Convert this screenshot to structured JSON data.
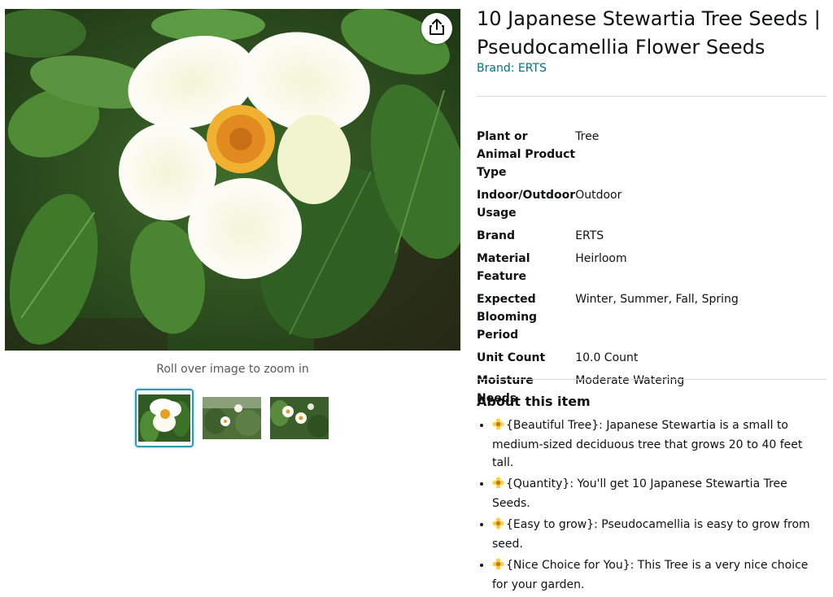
{
  "product": {
    "title": "10 Japanese Stewartia Tree Seeds | Pseudocamellia Flower Seeds",
    "brand_link": "Brand: ERTS"
  },
  "gallery": {
    "zoom_hint": "Roll over image to zoom in",
    "thumbnails": [
      {
        "alt": "thumbnail-1",
        "selected": true
      },
      {
        "alt": "thumbnail-2",
        "selected": false
      },
      {
        "alt": "thumbnail-3",
        "selected": false
      }
    ]
  },
  "specs": [
    {
      "key": "Plant or Animal Product Type",
      "value": "Tree"
    },
    {
      "key": "Indoor/Outdoor Usage",
      "value": "Outdoor"
    },
    {
      "key": "Brand",
      "value": "ERTS"
    },
    {
      "key": "Material Feature",
      "value": "Heirloom"
    },
    {
      "key": "Expected Blooming Period",
      "value": "Winter, Summer, Fall, Spring"
    },
    {
      "key": "Unit Count",
      "value": "10.0 Count"
    },
    {
      "key": "Moisture Needs",
      "value": "Moderate Watering"
    }
  ],
  "about": {
    "heading": "About this item",
    "items": [
      "{Beautiful Tree}: Japanese Stewartia is a small to medium-sized deciduous tree that grows 20 to 40 feet tall.",
      "{Quantity}: You'll get 10 Japanese Stewartia Tree Seeds.",
      "{Easy to grow}: Pseudocamellia is easy to grow from seed.",
      "{Nice Choice for You}: This Tree is a very nice choice for your garden."
    ]
  },
  "icons": {
    "share": "share-icon",
    "bullet": "sunflower-icon"
  },
  "colors": {
    "link": "#007185",
    "thumb_selected_border": "#2a9bb3",
    "text": "#0f1111",
    "muted": "#565959"
  }
}
